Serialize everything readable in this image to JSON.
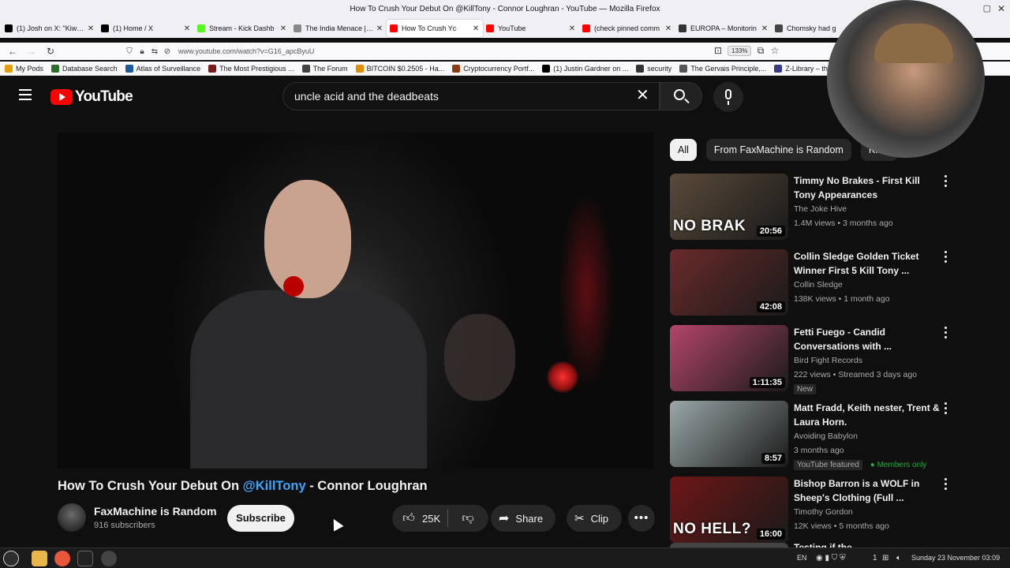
{
  "window": {
    "title": "How To Crush Your Debut On @KillTony - Connor Loughran - YouTube — Mozilla Firefox"
  },
  "tabs": [
    {
      "label": "(1) Josh on X: \"Kiwi F",
      "favicon": "x-icon",
      "color": "#000000"
    },
    {
      "label": "(1) Home / X",
      "favicon": "x-icon",
      "color": "#000000"
    },
    {
      "label": "Stream - Kick Dashb",
      "favicon": "kick-icon",
      "color": "#53fc18"
    },
    {
      "label": "The India Menace | Page",
      "favicon": "page-icon",
      "color": "#888888"
    },
    {
      "label": "How To Crush Yc",
      "favicon": "youtube-icon",
      "color": "#ff0000",
      "active": true
    },
    {
      "label": "YouTube",
      "favicon": "youtube-icon",
      "color": "#ff0000"
    },
    {
      "label": "(check pinned comm",
      "favicon": "youtube-icon",
      "color": "#ff0000"
    },
    {
      "label": "EUROPA – Monitorin",
      "favicon": "europa-icon",
      "color": "#333333"
    },
    {
      "label": "Chomsky had g",
      "favicon": "globe-icon",
      "color": "#444444"
    }
  ],
  "navbar": {
    "url": "www.youtube.com/watch?v=G16_apcByuU",
    "zoom": "133%"
  },
  "bookmarks": [
    {
      "label": "My Pods",
      "color": "#e5a000"
    },
    {
      "label": "Database Search",
      "color": "#2a6e2a"
    },
    {
      "label": "Atlas of Surveillance",
      "color": "#1c5a9c"
    },
    {
      "label": "The Most Prestigious ...",
      "color": "#7a1b1b"
    },
    {
      "label": "The Forum",
      "color": "#444444"
    },
    {
      "label": "BITCOIN $0.2505 - Ha...",
      "color": "#e58e00"
    },
    {
      "label": "Cryptocurrency Portf...",
      "color": "#8a3b12"
    },
    {
      "label": "(1) Justin Gardner on ...",
      "color": "#000000"
    },
    {
      "label": "security",
      "color": "#333333"
    },
    {
      "label": "The Gervais Principle,...",
      "color": "#555555"
    },
    {
      "label": "Z-Library – the wo",
      "color": "#3a3a8a"
    }
  ],
  "search": {
    "query": "uncle acid and the deadbeats"
  },
  "video": {
    "title_before": "How To Crush Your Debut On ",
    "title_mention": "@KillTony",
    "title_after": " - Connor Loughran",
    "channel": "FaxMachine is Random",
    "subscribers": "916 subscribers",
    "subscribe_label": "Subscribe",
    "likes": "25K",
    "share_label": "Share",
    "clip_label": "Clip"
  },
  "chips": [
    {
      "label": "All",
      "active": true
    },
    {
      "label": "From FaxMachine is Random",
      "active": false
    },
    {
      "label": "Kill T",
      "active": false
    }
  ],
  "recommendations": [
    {
      "title": "Timmy No Brakes - First Kill Tony Appearances",
      "channel": "The Joke Hive",
      "meta": "1.4M views • 3 months ago",
      "duration": "20:56",
      "thumb_text": "NO BRAK",
      "thumb_color": "#5a4a3a",
      "badges": []
    },
    {
      "title": "Collin Sledge Golden Ticket Winner First 5 Kill Tony ...",
      "channel": "Collin Sledge",
      "meta": "138K views • 1 month ago",
      "duration": "42:08",
      "thumb_text": "",
      "thumb_color": "#6a2a2a",
      "badges": []
    },
    {
      "title": "Fetti Fuego - Candid Conversations with ...",
      "channel": "Bird Fight Records",
      "meta": "222 views • Streamed 3 days ago",
      "duration": "1:11:35",
      "thumb_text": "",
      "thumb_color": "#b3456a",
      "badges": [
        "New"
      ]
    },
    {
      "title": "Matt Fradd, Keith nester, Trent & Laura Horn.",
      "channel": "Avoiding Babylon",
      "meta": "3 months ago",
      "duration": "8:57",
      "thumb_text": "",
      "thumb_color": "#9aa7a8",
      "badges": [
        "YouTube featured",
        "Members only"
      ]
    },
    {
      "title": "Bishop Barron is a WOLF in Sheep's Clothing (Full ...",
      "channel": "Timothy Gordon",
      "meta": "12K views • 5 months ago",
      "duration": "16:00",
      "thumb_text": "NO HELL?",
      "thumb_color": "#6e1616",
      "badges": []
    }
  ],
  "partial_rec_title": "Testing if the",
  "taskbar": {
    "lang": "EN",
    "clock": "Sunday 23 November 03:09",
    "tray_count": "1"
  }
}
